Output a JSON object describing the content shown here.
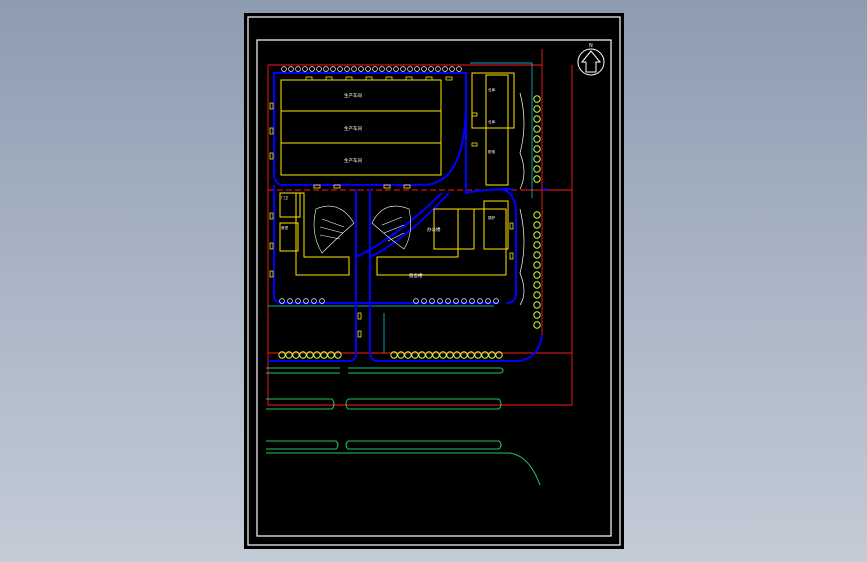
{
  "drawing": {
    "north_label": "N",
    "colors": {
      "background": "#8d9cb1",
      "sheet": "#000000",
      "frame": "#ffffff",
      "road": "#0000ff",
      "building": "#ffe600",
      "property_line": "#ff1a1a",
      "green": "#22c55e",
      "tree": "#c8ff3c",
      "cyan": "#00e5ff",
      "white": "#ffffff"
    },
    "buildings": [
      {
        "id": "workshop-1",
        "label": "生产车间"
      },
      {
        "id": "workshop-2",
        "label": "生产车间"
      },
      {
        "id": "workshop-3",
        "label": "生产车间"
      },
      {
        "id": "office",
        "label": "办公楼"
      },
      {
        "id": "dorm",
        "label": "宿舍楼"
      },
      {
        "id": "side-1",
        "label": "仓库"
      },
      {
        "id": "side-2",
        "label": "仓库"
      },
      {
        "id": "side-3",
        "label": "配电"
      },
      {
        "id": "side-4",
        "label": "锅炉"
      },
      {
        "id": "gate",
        "label": "门卫"
      },
      {
        "id": "canteen",
        "label": "食堂"
      }
    ]
  }
}
